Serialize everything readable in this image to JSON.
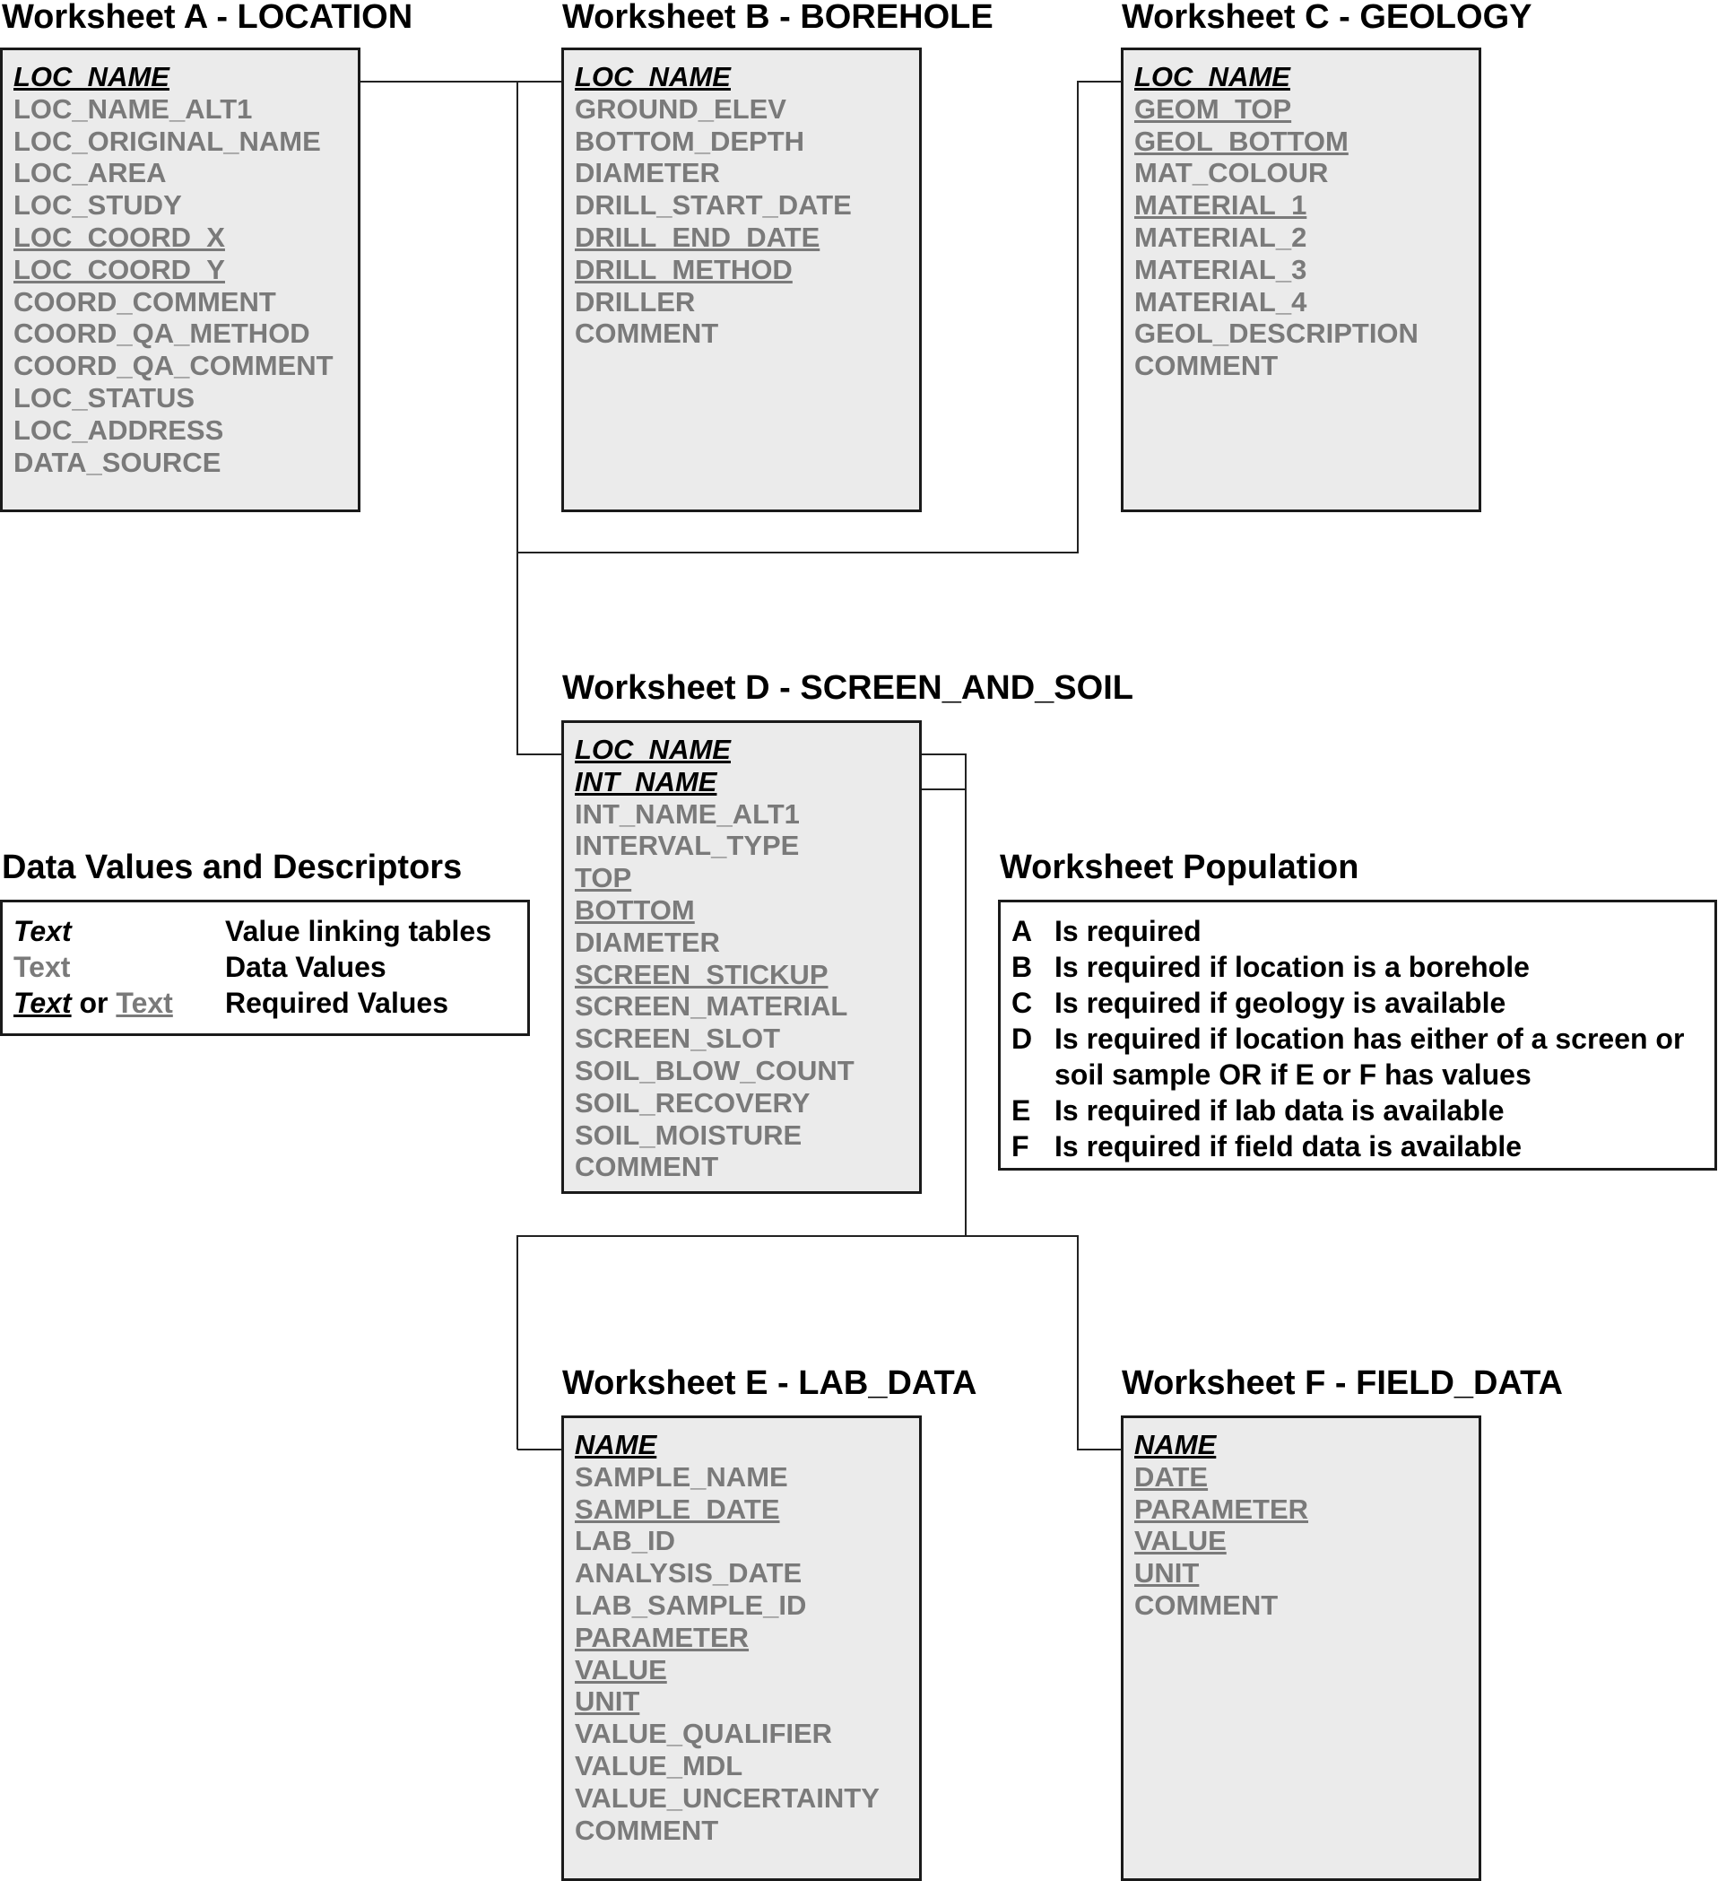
{
  "worksheets": [
    {
      "id": "A",
      "title": "Worksheet A - LOCATION",
      "fields": [
        {
          "name": "LOC_NAME",
          "kind": "link"
        },
        {
          "name": "LOC_NAME_ALT1",
          "kind": "data"
        },
        {
          "name": "LOC_ORIGINAL_NAME",
          "kind": "data"
        },
        {
          "name": "LOC_AREA",
          "kind": "data"
        },
        {
          "name": "LOC_STUDY",
          "kind": "data"
        },
        {
          "name": "LOC_COORD_X",
          "kind": "required"
        },
        {
          "name": "LOC_COORD_Y",
          "kind": "required"
        },
        {
          "name": "COORD_COMMENT",
          "kind": "data"
        },
        {
          "name": "COORD_QA_METHOD",
          "kind": "data"
        },
        {
          "name": "COORD_QA_COMMENT",
          "kind": "data"
        },
        {
          "name": "LOC_STATUS",
          "kind": "data"
        },
        {
          "name": "LOC_ADDRESS",
          "kind": "data"
        },
        {
          "name": "DATA_SOURCE",
          "kind": "data"
        }
      ]
    },
    {
      "id": "B",
      "title": "Worksheet B - BOREHOLE",
      "fields": [
        {
          "name": "LOC_NAME",
          "kind": "link"
        },
        {
          "name": "GROUND_ELEV",
          "kind": "data"
        },
        {
          "name": "BOTTOM_DEPTH",
          "kind": "data"
        },
        {
          "name": "DIAMETER",
          "kind": "data"
        },
        {
          "name": "DRILL_START_DATE",
          "kind": "data"
        },
        {
          "name": "DRILL_END_DATE",
          "kind": "required"
        },
        {
          "name": "DRILL_METHOD",
          "kind": "required"
        },
        {
          "name": "DRILLER",
          "kind": "data"
        },
        {
          "name": "COMMENT",
          "kind": "data"
        }
      ]
    },
    {
      "id": "C",
      "title": "Worksheet C - GEOLOGY",
      "fields": [
        {
          "name": "LOC_NAME",
          "kind": "link"
        },
        {
          "name": "GEOM_TOP",
          "kind": "required"
        },
        {
          "name": "GEOL_BOTTOM",
          "kind": "required"
        },
        {
          "name": "MAT_COLOUR",
          "kind": "data"
        },
        {
          "name": "MATERIAL_1",
          "kind": "required"
        },
        {
          "name": "MATERIAL_2",
          "kind": "data"
        },
        {
          "name": "MATERIAL_3",
          "kind": "data"
        },
        {
          "name": "MATERIAL_4",
          "kind": "data"
        },
        {
          "name": "GEOL_DESCRIPTION",
          "kind": "data"
        },
        {
          "name": "COMMENT",
          "kind": "data"
        }
      ]
    },
    {
      "id": "D",
      "title": "Worksheet D - SCREEN_AND_SOIL",
      "fields": [
        {
          "name": "LOC_NAME",
          "kind": "link"
        },
        {
          "name": "INT_NAME",
          "kind": "link"
        },
        {
          "name": "INT_NAME_ALT1",
          "kind": "data"
        },
        {
          "name": "INTERVAL_TYPE",
          "kind": "data"
        },
        {
          "name": "TOP",
          "kind": "required"
        },
        {
          "name": "BOTTOM",
          "kind": "required"
        },
        {
          "name": "DIAMETER",
          "kind": "data"
        },
        {
          "name": "SCREEN_STICKUP",
          "kind": "required"
        },
        {
          "name": "SCREEN_MATERIAL",
          "kind": "data"
        },
        {
          "name": "SCREEN_SLOT",
          "kind": "data"
        },
        {
          "name": "SOIL_BLOW_COUNT",
          "kind": "data"
        },
        {
          "name": "SOIL_RECOVERY",
          "kind": "data"
        },
        {
          "name": "SOIL_MOISTURE",
          "kind": "data"
        },
        {
          "name": "COMMENT",
          "kind": "data"
        }
      ]
    },
    {
      "id": "E",
      "title": "Worksheet E - LAB_DATA",
      "fields": [
        {
          "name": "NAME",
          "kind": "link"
        },
        {
          "name": "SAMPLE_NAME",
          "kind": "data"
        },
        {
          "name": "SAMPLE_DATE",
          "kind": "required"
        },
        {
          "name": "LAB_ID",
          "kind": "data"
        },
        {
          "name": "ANALYSIS_DATE",
          "kind": "data"
        },
        {
          "name": "LAB_SAMPLE_ID",
          "kind": "data"
        },
        {
          "name": "PARAMETER",
          "kind": "required"
        },
        {
          "name": "VALUE",
          "kind": "required"
        },
        {
          "name": "UNIT",
          "kind": "required"
        },
        {
          "name": "VALUE_QUALIFIER",
          "kind": "data"
        },
        {
          "name": "VALUE_MDL",
          "kind": "data"
        },
        {
          "name": "VALUE_UNCERTAINTY",
          "kind": "data"
        },
        {
          "name": "COMMENT",
          "kind": "data"
        }
      ]
    },
    {
      "id": "F",
      "title": "Worksheet F - FIELD_DATA",
      "fields": [
        {
          "name": "NAME",
          "kind": "link"
        },
        {
          "name": "DATE",
          "kind": "required"
        },
        {
          "name": "PARAMETER",
          "kind": "required"
        },
        {
          "name": "VALUE",
          "kind": "required"
        },
        {
          "name": "UNIT",
          "kind": "required"
        },
        {
          "name": "COMMENT",
          "kind": "data"
        }
      ]
    }
  ],
  "legend": {
    "title": "Data Values and Descriptors",
    "rows": [
      {
        "sample": "Text",
        "description": "Value linking tables"
      },
      {
        "sample": "Text",
        "description": "Data Values"
      },
      {
        "sample_a": "Text",
        "connector": "or",
        "sample_b": "Text",
        "description": "Required Values"
      }
    ]
  },
  "population": {
    "title": "Worksheet Population",
    "rows": [
      {
        "letter": "A",
        "text": "Is required"
      },
      {
        "letter": "B",
        "text": "Is required if location is a borehole"
      },
      {
        "letter": "C",
        "text": "Is required if geology is available"
      },
      {
        "letter": "D",
        "text": "Is required if location has either of a screen or soil sample OR if E or F has values"
      },
      {
        "letter": "E",
        "text": "Is required if lab data is available"
      },
      {
        "letter": "F",
        "text": "Is required if field data is available"
      }
    ]
  },
  "colors": {
    "box_fill": "#ebebeb",
    "border": "#1a1a1a",
    "data_text": "#7a7a7a",
    "link_text": "#000000"
  }
}
